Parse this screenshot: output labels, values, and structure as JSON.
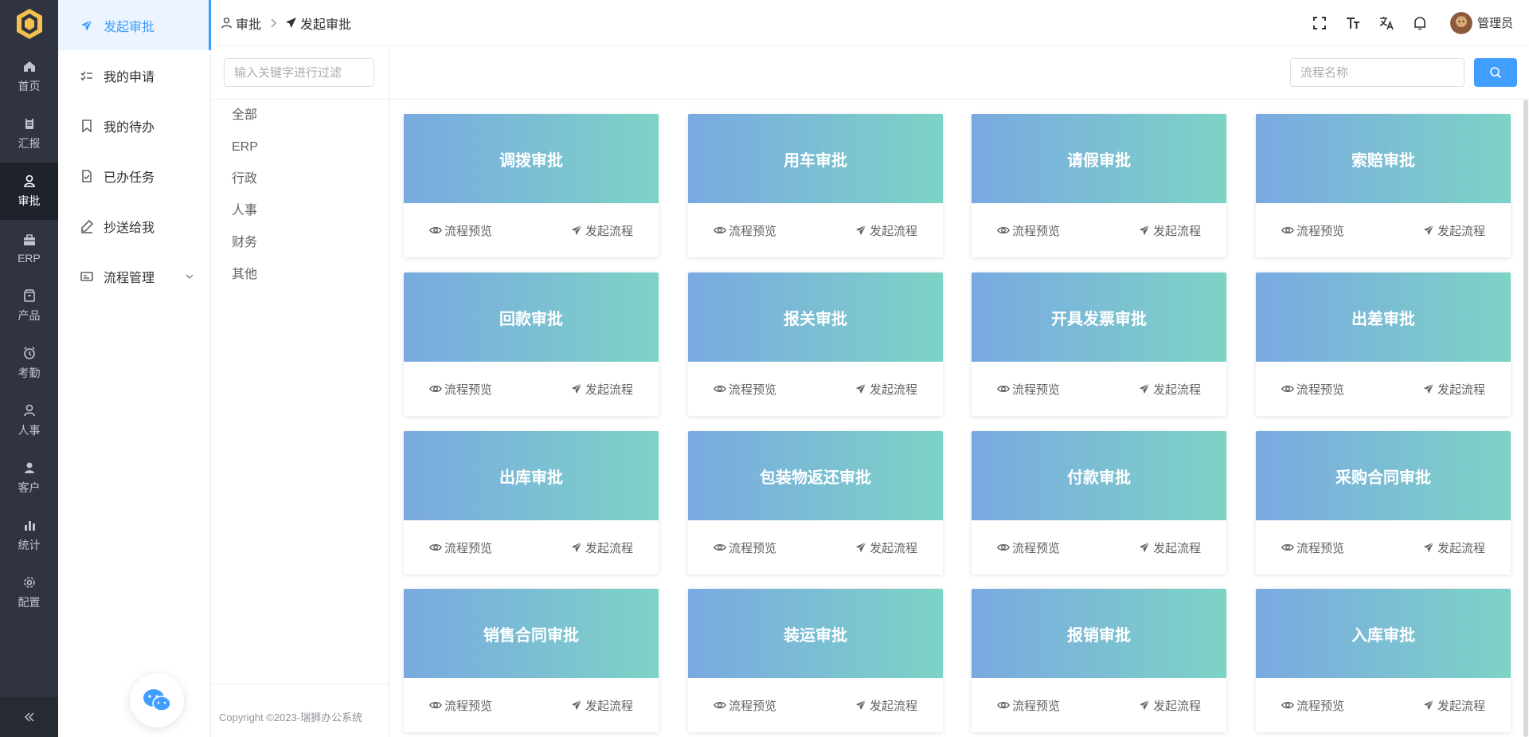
{
  "rail": {
    "items": [
      {
        "label": "首页",
        "icon": "home-icon"
      },
      {
        "label": "汇报",
        "icon": "clipboard-icon"
      },
      {
        "label": "审批",
        "icon": "user-stamp-icon",
        "active": true
      },
      {
        "label": "ERP",
        "icon": "briefcase-icon"
      },
      {
        "label": "产品",
        "icon": "box-icon"
      },
      {
        "label": "考勤",
        "icon": "alarm-clock-icon"
      },
      {
        "label": "人事",
        "icon": "person-icon"
      },
      {
        "label": "客户",
        "icon": "customer-icon"
      },
      {
        "label": "统计",
        "icon": "bar-chart-icon"
      },
      {
        "label": "配置",
        "icon": "gear-icon"
      }
    ]
  },
  "submenu": {
    "items": [
      {
        "label": "发起审批",
        "icon": "paper-plane-icon",
        "active": true
      },
      {
        "label": "我的申请",
        "icon": "checklist-icon"
      },
      {
        "label": "我的待办",
        "icon": "bookmark-icon"
      },
      {
        "label": "已办任务",
        "icon": "doc-check-icon"
      },
      {
        "label": "抄送给我",
        "icon": "pen-icon"
      },
      {
        "label": "流程管理",
        "icon": "id-card-icon",
        "has_children": true
      }
    ]
  },
  "header": {
    "breadcrumb": [
      {
        "label": "审批",
        "icon": "user-stamp-icon"
      },
      {
        "label": "发起审批",
        "icon": "paper-plane-icon"
      }
    ],
    "user_name": "管理员"
  },
  "categories": {
    "filter_placeholder": "输入关键字进行过滤",
    "items": [
      "全部",
      "ERP",
      "行政",
      "人事",
      "财务",
      "其他"
    ],
    "copyright": "Copyright ©2023-瑞狮办公系统"
  },
  "main": {
    "search_placeholder": "流程名称",
    "preview_label": "流程预览",
    "start_label": "发起流程",
    "cards": [
      "调拨审批",
      "用车审批",
      "请假审批",
      "索赔审批",
      "回款审批",
      "报关审批",
      "开具发票审批",
      "出差审批",
      "出库审批",
      "包装物返还审批",
      "付款审批",
      "采购合同审批",
      "销售合同审批",
      "装运审批",
      "报销审批",
      "入库审批"
    ]
  },
  "colors": {
    "accent": "#409eff",
    "rail_bg": "#2f3440",
    "card_gradient_start": "#79a9e1",
    "card_gradient_end": "#7dd3c6"
  }
}
